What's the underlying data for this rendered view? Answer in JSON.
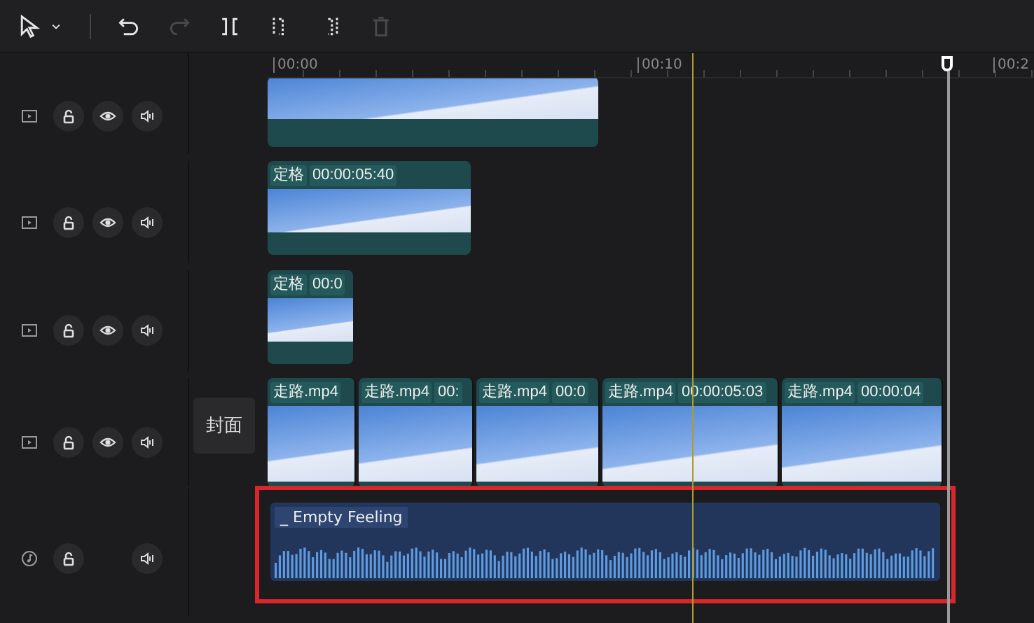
{
  "toolbar": [
    {
      "kind": "select",
      "disabled": false
    },
    {
      "kind": "caret",
      "disabled": false
    },
    {
      "kind": "undo",
      "disabled": false
    },
    {
      "kind": "redo",
      "disabled": true
    },
    {
      "kind": "split",
      "disabled": false
    },
    {
      "kind": "split-left",
      "disabled": false
    },
    {
      "kind": "split-right",
      "disabled": false
    },
    {
      "kind": "delete",
      "disabled": true
    }
  ],
  "ruler": [
    "00:00",
    "00:10",
    "00:2"
  ],
  "cover_button": "封面",
  "tracks": [
    {
      "kind": "video",
      "highlighted": false,
      "clips": [
        {
          "kind": "plain"
        }
      ]
    },
    {
      "kind": "video",
      "highlighted": false,
      "clips": [
        {
          "kind": "labeled",
          "name": "定格",
          "duration": "00:00:05:40"
        }
      ]
    },
    {
      "kind": "video",
      "highlighted": false,
      "clips": [
        {
          "kind": "labeled",
          "name": "定格",
          "duration": "00:0"
        }
      ]
    },
    {
      "kind": "video",
      "highlighted": false,
      "clips": [
        {
          "kind": "labeled",
          "name": "走路.mp4"
        },
        {
          "kind": "labeled",
          "name": "走路.mp4",
          "duration": "00:"
        },
        {
          "kind": "labeled",
          "name": "走路.mp4",
          "duration": "00:0"
        },
        {
          "kind": "labeled",
          "name": "走路.mp4",
          "duration": "00:00:05:03"
        },
        {
          "kind": "labeled",
          "name": "走路.mp4",
          "duration": "00:00:04"
        }
      ]
    },
    {
      "kind": "audio",
      "highlighted": true,
      "clips": [
        {
          "kind": "labeled",
          "name": "_ Empty Feeling"
        }
      ]
    }
  ]
}
